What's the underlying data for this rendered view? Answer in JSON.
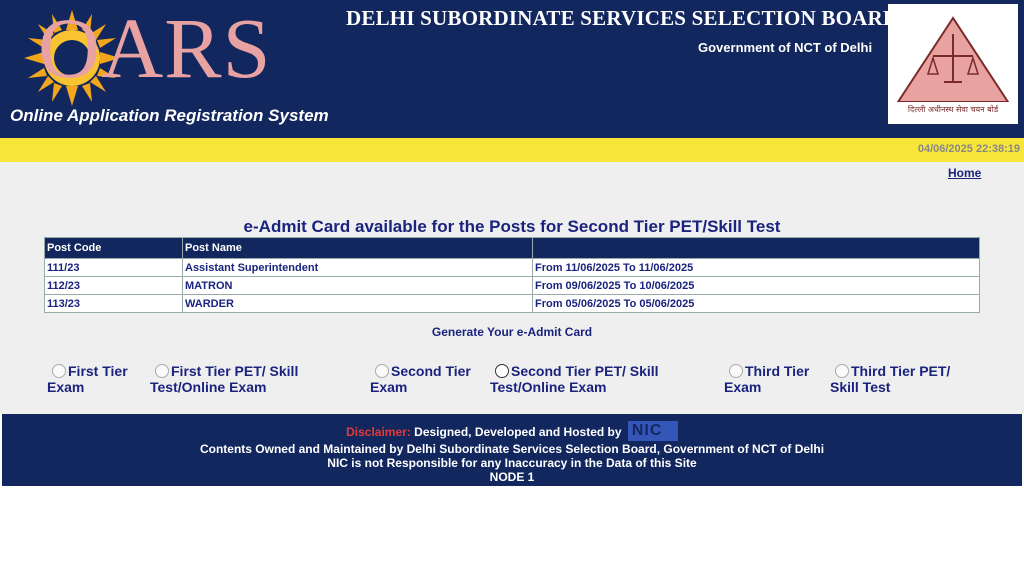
{
  "header": {
    "logo_text": "OARS",
    "tagline": "Online Application Registration System",
    "board_title": "DELHI SUBORDINATE SERVICES SELECTION BOARD",
    "government": "Government of NCT of Delhi",
    "seal_text": "दिल्ली अधीनस्थ सेवा चयन बोर्ड"
  },
  "datetime": "04/06/2025 22:38:19",
  "nav": {
    "home": "Home"
  },
  "heading": "e-Admit Card available for the Posts for Second Tier PET/Skill Test",
  "table": {
    "headers": [
      "Post Code",
      "Post Name",
      ""
    ],
    "rows": [
      [
        "111/23",
        "Assistant Superintendent",
        "From 11/06/2025 To 11/06/2025"
      ],
      [
        "112/23",
        "MATRON",
        "From 09/06/2025 To 10/06/2025"
      ],
      [
        "113/23",
        "WARDER",
        "From 05/06/2025 To 05/06/2025"
      ]
    ]
  },
  "generate_label": "Generate Your e-Admit Card",
  "options": [
    {
      "line1": "First Tier",
      "line2": "Exam"
    },
    {
      "line1": "First Tier PET/ Skill",
      "line2": "Test/Online Exam"
    },
    {
      "line1": "Second Tier",
      "line2": "Exam"
    },
    {
      "line1": "Second Tier PET/ Skill",
      "line2": "Test/Online Exam"
    },
    {
      "line1": "Third Tier",
      "line2": "Exam"
    },
    {
      "line1": "Third Tier PET/",
      "line2": "Skill Test"
    }
  ],
  "footer": {
    "disclaimer_label": "Disclaimer:",
    "line1": "Designed, Developed and Hosted by",
    "nic_logo": "NIC",
    "line2": "Contents Owned and Maintained by Delhi Subordinate Services Selection Board, Government of NCT of Delhi",
    "line3": "NIC is not Responsible for any Inaccuracy in the Data of this Site",
    "line4": "NODE 1"
  },
  "colors": {
    "header_bg": "#13275f",
    "yellow_bar": "#f8e53a",
    "text_navy": "#1a237e",
    "disclaimer_red": "#e53935",
    "logo_pink": "#e8a2a2"
  }
}
